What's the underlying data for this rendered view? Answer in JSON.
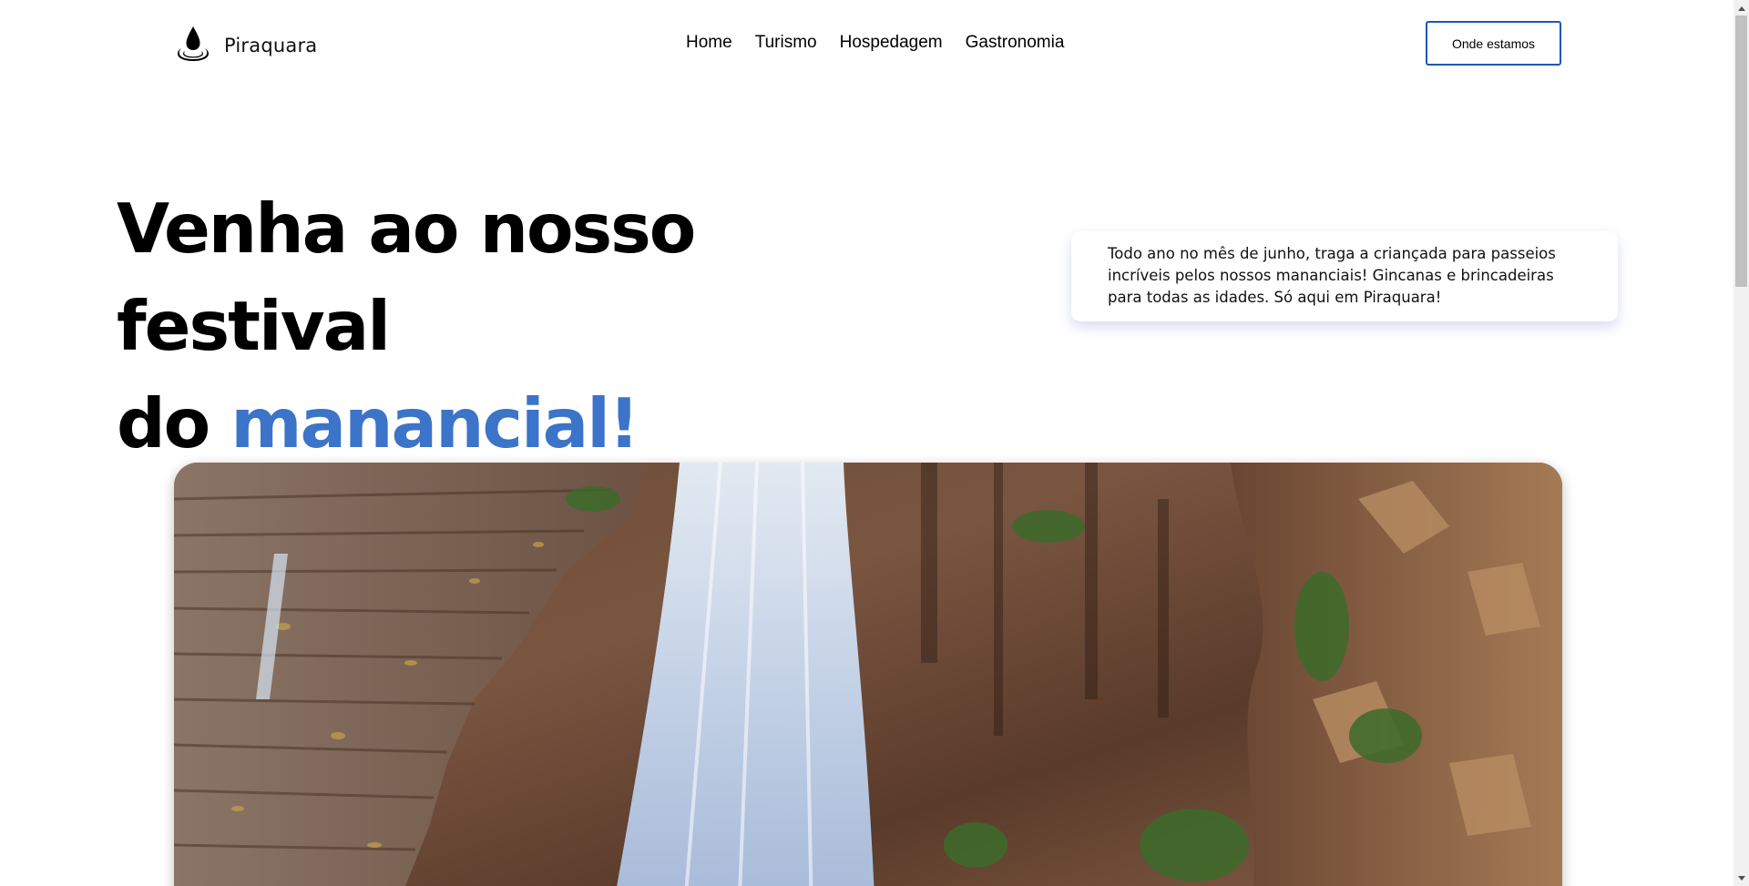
{
  "header": {
    "brand_name": "Piraquara",
    "logo_icon": "water-drop-icon",
    "nav": [
      {
        "label": "Home"
      },
      {
        "label": "Turismo"
      },
      {
        "label": "Hospedagem"
      },
      {
        "label": "Gastronomia"
      }
    ],
    "cta_label": "Onde estamos"
  },
  "hero": {
    "title_line1": "Venha ao nosso festival",
    "title_line2_prefix": "do",
    "title_line2_accent": "manancial!",
    "description": "Todo ano no mês de junho, traga a criançada para passeios incríveis pelos nossos mananciais! Gincanas e brincadeiras para todas as idades. Só aqui em Piraquara!"
  },
  "photo": {
    "subject": "waterfall over mossy rocks"
  },
  "colors": {
    "accent": "#3b74c8",
    "cta_border": "#1f57b8",
    "text": "#000000",
    "background": "#ffffff"
  }
}
